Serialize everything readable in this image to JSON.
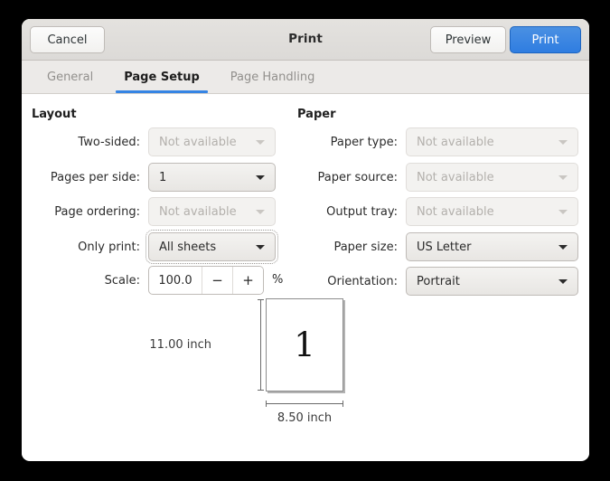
{
  "header": {
    "title": "Print",
    "cancel_label": "Cancel",
    "preview_label": "Preview",
    "print_label": "Print",
    "print_button_color": "#3584e4"
  },
  "tabs": [
    {
      "label": "General",
      "active": false
    },
    {
      "label": "Page Setup",
      "active": true
    },
    {
      "label": "Page Handling",
      "active": false
    }
  ],
  "tab_accent_color": "#3584e4",
  "layout": {
    "section_title": "Layout",
    "rows": [
      {
        "label": "Two-sided:",
        "value": "Not available",
        "enabled": false
      },
      {
        "label": "Pages per side:",
        "value": "1",
        "enabled": true
      },
      {
        "label": "Page ordering:",
        "value": "Not available",
        "enabled": false
      },
      {
        "label": "Only print:",
        "value": "All sheets",
        "enabled": true,
        "focused": true
      }
    ],
    "scale": {
      "label": "Scale:",
      "value": "100.0",
      "decrement_label": "−",
      "increment_label": "+",
      "unit": "%"
    }
  },
  "paper": {
    "section_title": "Paper",
    "rows": [
      {
        "label": "Paper type:",
        "value": "Not available",
        "enabled": false
      },
      {
        "label": "Paper source:",
        "value": "Not available",
        "enabled": false
      },
      {
        "label": "Output tray:",
        "value": "Not available",
        "enabled": false
      },
      {
        "label": "Paper size:",
        "value": "US Letter",
        "enabled": true
      },
      {
        "label": "Orientation:",
        "value": "Portrait",
        "enabled": true
      }
    ]
  },
  "preview": {
    "page_number": "1",
    "height_label": "11.00 inch",
    "width_label": "8.50 inch"
  }
}
